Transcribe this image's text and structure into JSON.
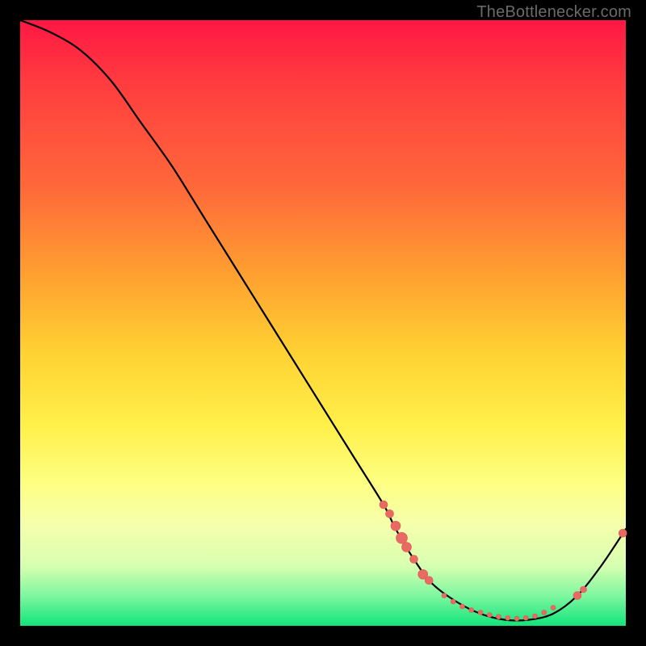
{
  "watermark": "TheBottlenecker.com",
  "colors": {
    "curve_stroke": "#000000",
    "marker_fill": "#e96a63",
    "marker_stroke": "#d95a55"
  },
  "chart_data": {
    "type": "line",
    "title": "",
    "xlabel": "",
    "ylabel": "",
    "xlim": [
      0,
      100
    ],
    "ylim": [
      0,
      100
    ],
    "series": [
      {
        "name": "bottleneck-curve",
        "x": [
          0,
          5,
          10,
          15,
          20,
          25,
          30,
          35,
          40,
          45,
          50,
          55,
          60,
          62,
          65,
          68,
          72,
          76,
          80,
          84,
          88,
          92,
          96,
          100
        ],
        "y": [
          100,
          98,
          95,
          90,
          83,
          76,
          68,
          60,
          52,
          44,
          36,
          28,
          20,
          16,
          11,
          7,
          4,
          2,
          1,
          1,
          2,
          5,
          10,
          16
        ]
      }
    ],
    "markers": [
      {
        "x": 60.0,
        "y": 20.0,
        "r": 5
      },
      {
        "x": 61.0,
        "y": 18.5,
        "r": 5
      },
      {
        "x": 62.0,
        "y": 16.5,
        "r": 6
      },
      {
        "x": 63.0,
        "y": 14.5,
        "r": 7
      },
      {
        "x": 63.8,
        "y": 13.0,
        "r": 6
      },
      {
        "x": 65.0,
        "y": 11.0,
        "r": 5
      },
      {
        "x": 66.5,
        "y": 8.5,
        "r": 6
      },
      {
        "x": 67.5,
        "y": 7.5,
        "r": 5
      },
      {
        "x": 70.0,
        "y": 5.0,
        "r": 3
      },
      {
        "x": 71.5,
        "y": 4.0,
        "r": 3
      },
      {
        "x": 73.0,
        "y": 3.2,
        "r": 3
      },
      {
        "x": 74.5,
        "y": 2.6,
        "r": 3
      },
      {
        "x": 76.0,
        "y": 2.2,
        "r": 3
      },
      {
        "x": 77.5,
        "y": 1.8,
        "r": 3
      },
      {
        "x": 79.0,
        "y": 1.5,
        "r": 3
      },
      {
        "x": 80.5,
        "y": 1.3,
        "r": 3
      },
      {
        "x": 82.0,
        "y": 1.2,
        "r": 3
      },
      {
        "x": 83.5,
        "y": 1.3,
        "r": 3
      },
      {
        "x": 85.0,
        "y": 1.6,
        "r": 3
      },
      {
        "x": 86.5,
        "y": 2.2,
        "r": 3
      },
      {
        "x": 88.0,
        "y": 3.0,
        "r": 3
      },
      {
        "x": 92.0,
        "y": 5.0,
        "r": 5
      },
      {
        "x": 93.0,
        "y": 6.0,
        "r": 4
      },
      {
        "x": 99.5,
        "y": 15.3,
        "r": 5
      }
    ]
  }
}
